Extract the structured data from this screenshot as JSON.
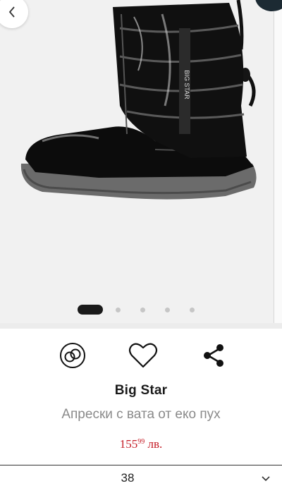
{
  "gallery": {
    "slide_count": 5,
    "active_slide": 1,
    "image_alt_name": "boot-product-image",
    "logo_text": "BIG STAR"
  },
  "actions": {
    "compare_icon": "compare-icon",
    "favorite_icon": "heart-icon",
    "share_icon": "share-icon"
  },
  "product": {
    "brand": "Big Star",
    "name": "Апрески с вата от еко пух",
    "price_main": "155",
    "price_cents": "99",
    "price_currency": "лв."
  },
  "size": {
    "selected": "38"
  },
  "colors": {
    "price": "#c41a24",
    "dot_active": "#1a1a1a",
    "dot_inactive": "#c6c6c6",
    "gallery_bg": "#f1f1f1"
  }
}
